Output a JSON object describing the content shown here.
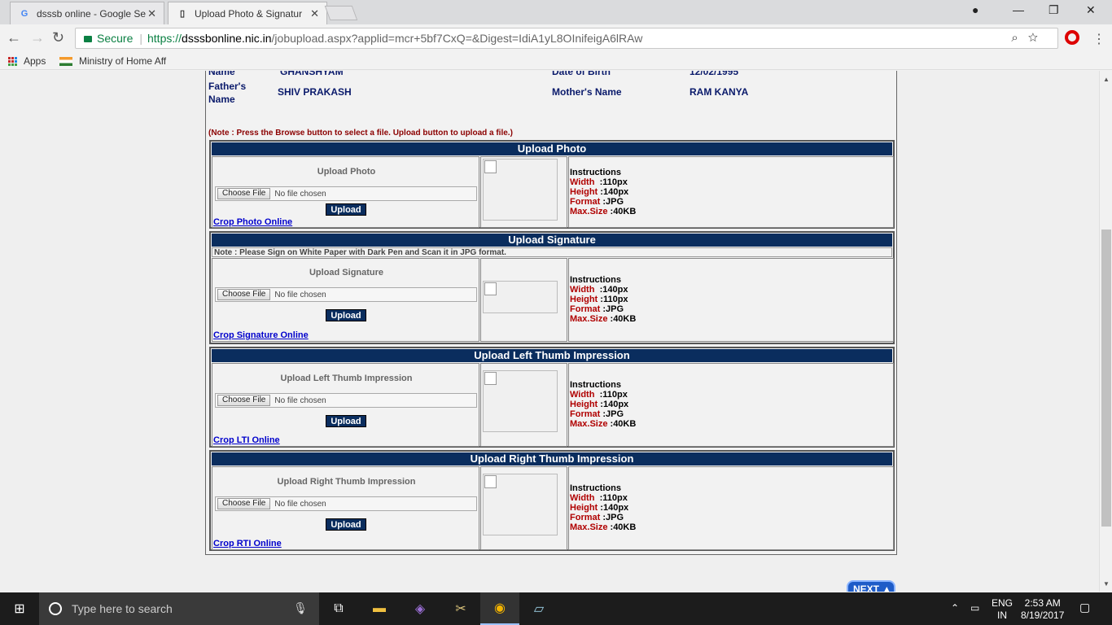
{
  "tabs": [
    {
      "title": "dsssb online - Google Se",
      "icon": "google-icon"
    },
    {
      "title": "Upload Photo & Signatur",
      "icon": "page-icon"
    }
  ],
  "address": {
    "secure": "Secure",
    "scheme": "https://",
    "domain": "dsssbonline.nic.in",
    "path": "/jobupload.aspx?applid=mcr+5bf7CxQ=&Digest=IdiA1yL8OInifeigA6lRAw"
  },
  "bookmarks": {
    "apps": "Apps",
    "ministry": "Ministry of Home Aff"
  },
  "info": {
    "name_label": "Name",
    "name_value": "GHANSHYAM",
    "dob_label": "Date of Birth",
    "dob_value": "12/02/1995",
    "father_label": "Father's Name",
    "father_value": "SHIV PRAKASH",
    "mother_label": "Mother's Name",
    "mother_value": "RAM KANYA"
  },
  "note": "(Note : Press the Browse button to select a file. Upload button to upload a file.)",
  "choose_file": "Choose File",
  "no_file": "No file chosen",
  "upload_btn": "Upload",
  "ins": {
    "title": "Instructions",
    "width": "Width",
    "height": "Height",
    "format": "Format",
    "maxsize": "Max.Size"
  },
  "sections": [
    {
      "header": "Upload Photo",
      "label": "Upload Photo",
      "crop": "Crop Photo Online",
      "width": ":110px",
      "height": ":140px",
      "format": ":JPG",
      "maxsize": ":40KB"
    },
    {
      "header": "Upload Signature",
      "note": "Note : Please Sign on White Paper with Dark Pen and Scan it in JPG format.",
      "label": "Upload Signature",
      "crop": "Crop Signature Online",
      "width": ":140px",
      "height": ":110px",
      "format": ":JPG",
      "maxsize": ":40KB"
    },
    {
      "header": "Upload Left Thumb Impression",
      "label": "Upload Left Thumb Impression",
      "crop": "Crop LTI Online",
      "width": ":110px",
      "height": ":140px",
      "format": ":JPG",
      "maxsize": ":40KB"
    },
    {
      "header": "Upload Right Thumb Impression",
      "label": "Upload Right Thumb Impression",
      "crop": "Crop RTI Online",
      "width": ":110px",
      "height": ":140px",
      "format": ":JPG",
      "maxsize": ":40KB"
    }
  ],
  "next": "NEXT",
  "taskbar": {
    "search": "Type here to search",
    "lang1": "ENG",
    "lang2": "IN",
    "time": "2:53 AM",
    "date": "8/19/2017"
  }
}
